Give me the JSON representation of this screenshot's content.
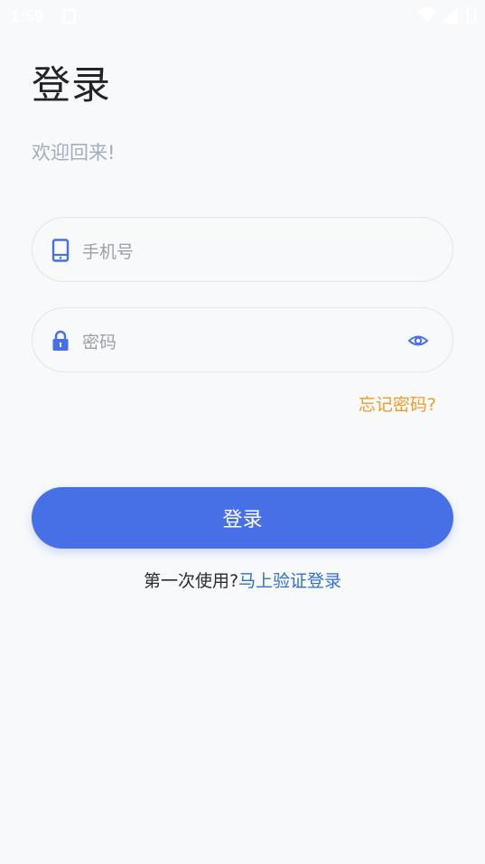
{
  "status_bar": {
    "time": "1:59"
  },
  "header": {
    "title": "登录",
    "subtitle": "欢迎回来!"
  },
  "form": {
    "phone": {
      "placeholder": "手机号",
      "icon": "phone-icon"
    },
    "password": {
      "placeholder": "密码",
      "icon": "lock-icon",
      "toggle_icon": "eye-icon"
    },
    "forgot_label": "忘记密码?"
  },
  "actions": {
    "login_label": "登录",
    "first_time_text": "第一次使用?",
    "verify_link": "马上验证登录"
  },
  "colors": {
    "accent": "#4770e6",
    "link": "#2f6fd4",
    "forgot": "#f29a27",
    "background": "#f8f9fb"
  }
}
